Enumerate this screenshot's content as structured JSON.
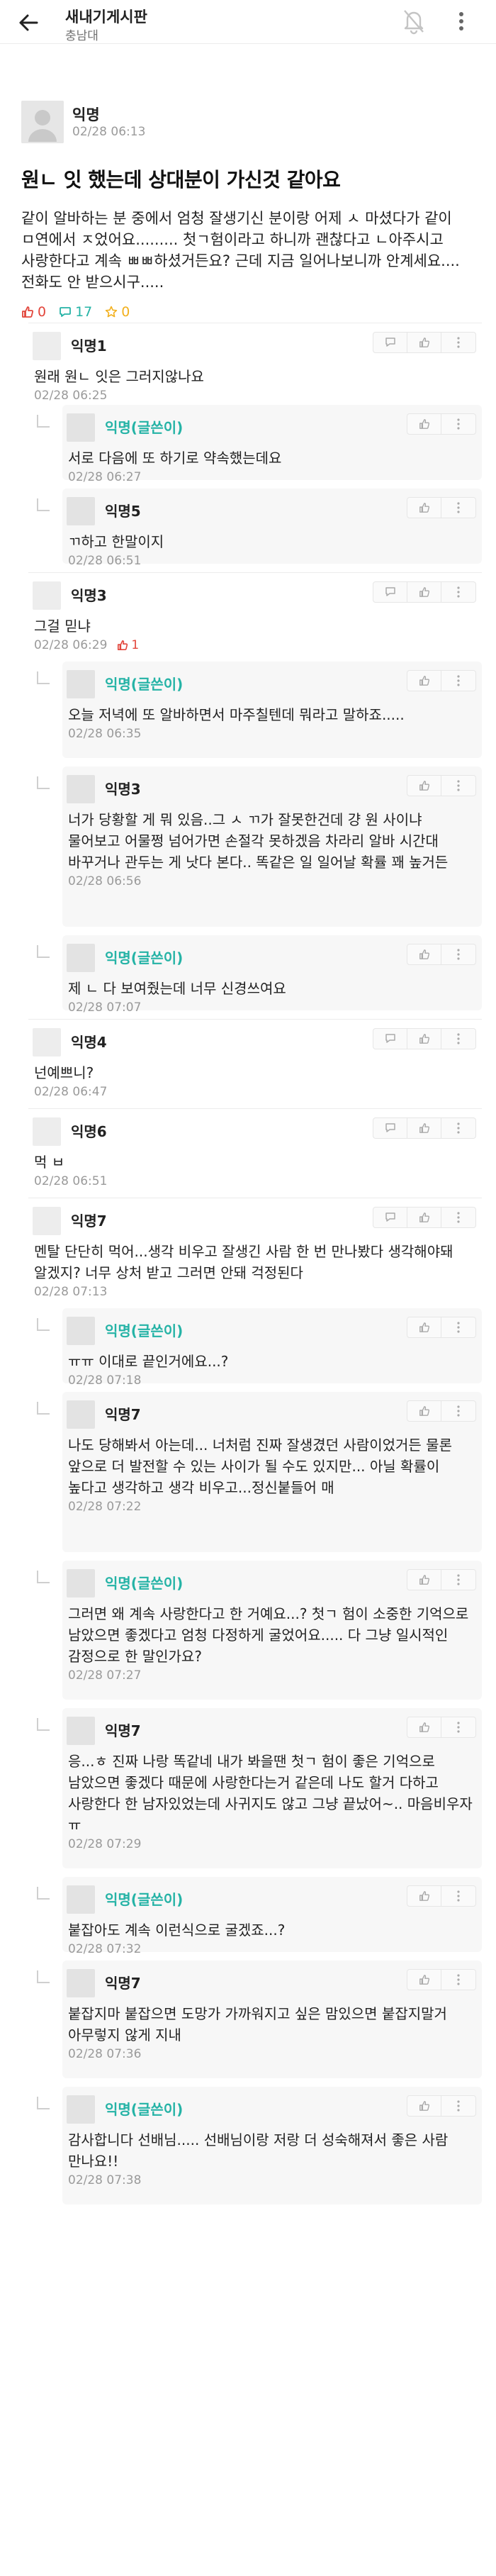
{
  "header": {
    "board_title": "새내기게시판",
    "school": "충남대",
    "icons": {
      "back": "back-arrow-icon",
      "bell": "bell-off-icon",
      "more": "more-vertical-icon"
    }
  },
  "article": {
    "author": "익명",
    "time": "02/28 06:13",
    "title": "원ㄴ 잇 했는데 상대분이 가신것 같아요",
    "body": "같이 알바하는 분 중에서 엄청 잘생기신 분이랑 어제 ㅅ 마셨다가 같이 ㅁ연에서 ㅈ었어요......... 첫ㄱ험이라고 하니까 괜찮다고 ㄴ아주시고 사랑한다고 계속 ㅃㅃ하셨거든요? 근데 지금 일어나보니까 안계세요.... 전화도 안 받으시구.....",
    "stats": {
      "likes": "0",
      "comments": "17",
      "scraps": "0"
    },
    "colors": {
      "like": "#e2453b",
      "comment": "#25b3a6",
      "scrap": "#f2b01e"
    }
  },
  "comments": [
    {
      "author": "익명1",
      "text": "원래 원ㄴ 잇은 그러지않나요",
      "time": "02/28 06:25",
      "reply": false,
      "op": false,
      "likes": ""
    },
    {
      "author": "익명(글쓴이)",
      "text": "서로 다음에 또 하기로 약속했는데요",
      "time": "02/28 06:27",
      "reply": true,
      "op": true,
      "likes": ""
    },
    {
      "author": "익명5",
      "text": "ㄲ하고 한말이지",
      "time": "02/28 06:51",
      "reply": true,
      "op": false,
      "likes": ""
    },
    {
      "author": "익명3",
      "text": "그걸 믿냐",
      "time": "02/28 06:29",
      "reply": false,
      "op": false,
      "likes": "1"
    },
    {
      "author": "익명(글쓴이)",
      "text": "오늘 저녁에 또 알바하면서 마주칠텐데 뭐라고 말하죠.....",
      "time": "02/28 06:35",
      "reply": true,
      "op": true,
      "likes": ""
    },
    {
      "author": "익명3",
      "text": "너가 당황할 게 뭐 있음..그 ㅅ ㄲ가 잘못한건데 걍 원 사이냐 물어보고 어물쩡 넘어가면 손절각 못하겠음 차라리 알바 시간대 바꾸거나 관두는 게 낫다 본다.. 똑같은 일 일어날 확률 꽤 높거든",
      "time": "02/28 06:56",
      "reply": true,
      "op": false,
      "likes": ""
    },
    {
      "author": "익명(글쓴이)",
      "text": "제 ㄴ 다 보여줬는데 너무 신경쓰여요",
      "time": "02/28 07:07",
      "reply": true,
      "op": true,
      "likes": ""
    },
    {
      "author": "익명4",
      "text": "넌예쁘니?",
      "time": "02/28 06:47",
      "reply": false,
      "op": false,
      "likes": ""
    },
    {
      "author": "익명6",
      "text": "먹 ㅂ",
      "time": "02/28 06:51",
      "reply": false,
      "op": false,
      "likes": ""
    },
    {
      "author": "익명7",
      "text": "멘탈 단단히 먹어...생각 비우고 잘생긴 사람 한 번 만나봤다 생각해야돼 알겠지? 너무 상처 받고 그러면 안돼 걱정된다",
      "time": "02/28 07:13",
      "reply": false,
      "op": false,
      "likes": ""
    },
    {
      "author": "익명(글쓴이)",
      "text": "ㅠㅠ 이대로 끝인거에요...?",
      "time": "02/28 07:18",
      "reply": true,
      "op": true,
      "likes": ""
    },
    {
      "author": "익명7",
      "text": "나도 당해봐서 아는데... 너처럼 진짜 잘생겼던 사람이었거든 물론 앞으로 더 발전할 수 있는 사이가 될 수도 있지만... 아닐 확률이 높다고 생각하고 생각 비우고...정신붙들어 매",
      "time": "02/28 07:22",
      "reply": true,
      "op": false,
      "likes": ""
    },
    {
      "author": "익명(글쓴이)",
      "text": "그러면 왜 계속 사랑한다고 한 거예요...? 첫ㄱ 험이 소중한 기억으로 남았으면 좋겠다고 엄청 다정하게 굴었어요..... 다 그냥 일시적인 감정으로 한 말인가요?",
      "time": "02/28 07:27",
      "reply": true,
      "op": true,
      "likes": ""
    },
    {
      "author": "익명7",
      "text": "응...ㅎ 진짜 나랑 똑같네 내가 봐을땐 첫ㄱ 험이 좋은 기억으로 남았으면 좋겠다 때문에 사랑한다는거 같은데 나도 할거 다하고 사랑한다 한 남자있었는데 사귀지도 않고 그냥 끝났어~.. 마음비우자 ㅠ",
      "time": "02/28 07:29",
      "reply": true,
      "op": false,
      "likes": ""
    },
    {
      "author": "익명(글쓴이)",
      "text": "붙잡아도 계속 이런식으로 굴겠죠...?",
      "time": "02/28 07:32",
      "reply": true,
      "op": true,
      "likes": ""
    },
    {
      "author": "익명7",
      "text": "붙잡지마 붙잡으면 도망가 가까워지고 싶은 맘있으면 붙잡지말거 아무렇지 않게 지내",
      "time": "02/28 07:36",
      "reply": true,
      "op": false,
      "likes": ""
    },
    {
      "author": "익명(글쓴이)",
      "text": "감사합니다 선배님..... 선배님이랑 저랑 더 성숙해져서 좋은 사람 만나요!!",
      "time": "02/28 07:38",
      "reply": true,
      "op": true,
      "likes": ""
    }
  ]
}
